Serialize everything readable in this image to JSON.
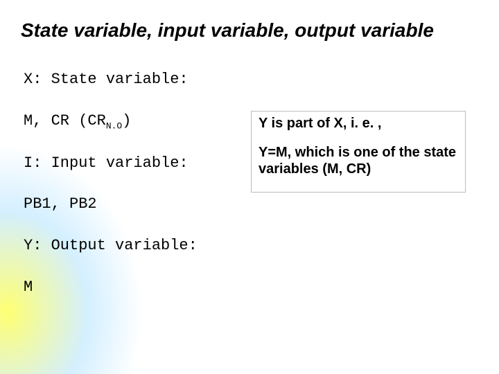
{
  "title": "State variable, input variable, output variable",
  "lines": {
    "x_label": "X: State variable:",
    "mcr_prefix": "M, CR (CR",
    "mcr_sub": "N.O",
    "mcr_suffix": ")",
    "i_label": "I: Input variable:",
    "pb": "PB1, PB2",
    "y_label": "Y: Output variable:",
    "m": "M"
  },
  "callout": {
    "line1": "Y is part of X, i. e. ,",
    "line2": "Y=M, which is one of the state variables (M, CR)"
  }
}
